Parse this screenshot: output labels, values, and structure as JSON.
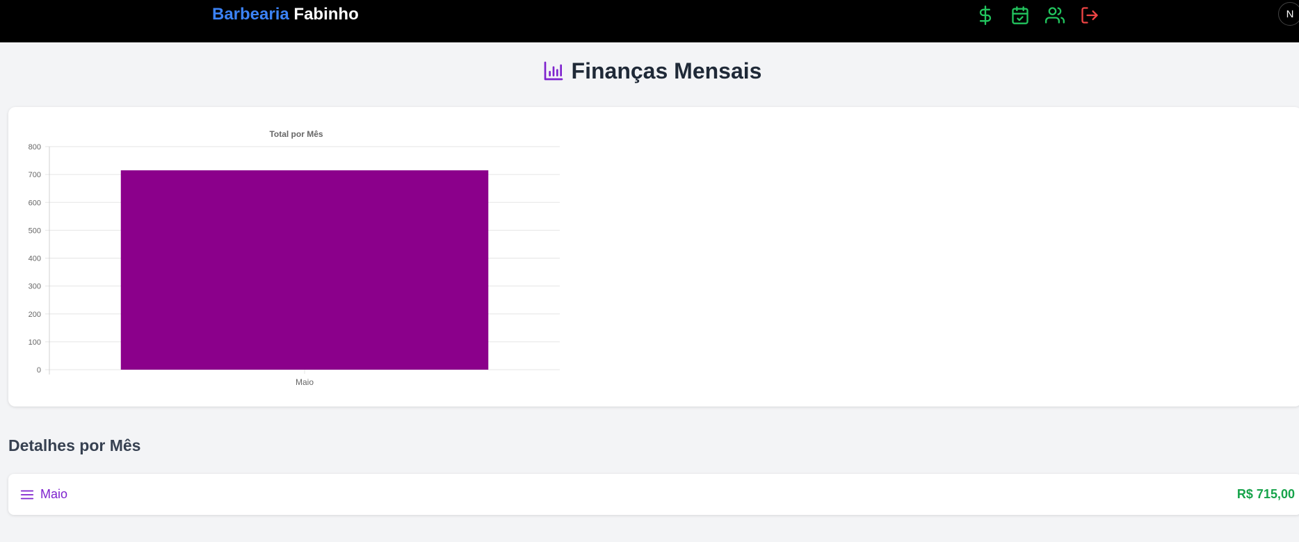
{
  "header": {
    "brand_first": "Barbearia",
    "brand_second": "Fabinho",
    "brand_colors": {
      "first": "#3b82f6",
      "second": "#ffffff"
    },
    "nav_icons": [
      {
        "name": "dollar-icon",
        "color": "#22c55e"
      },
      {
        "name": "calendar-check-icon",
        "color": "#22c55e"
      },
      {
        "name": "users-icon",
        "color": "#22c55e"
      },
      {
        "name": "logout-icon",
        "color": "#ef4444"
      }
    ],
    "avatar_initial": "N"
  },
  "page": {
    "title": "Finanças Mensais",
    "title_icon": "bar-chart-icon",
    "title_icon_color": "#7e22ce"
  },
  "chart_data": {
    "type": "bar",
    "title": "Total por Mês",
    "categories": [
      "Maio"
    ],
    "values": [
      715
    ],
    "ylim": [
      0,
      800
    ],
    "yticks": [
      0,
      100,
      200,
      300,
      400,
      500,
      600,
      700,
      800
    ],
    "bar_color": "#8b008b",
    "grid": true,
    "legend": false
  },
  "details": {
    "title": "Detalhes por Mês",
    "rows": [
      {
        "month": "Maio",
        "total": "R$ 715,00",
        "icon": "menu-icon"
      }
    ],
    "month_color": "#7e22ce",
    "total_color": "#16a34a"
  }
}
